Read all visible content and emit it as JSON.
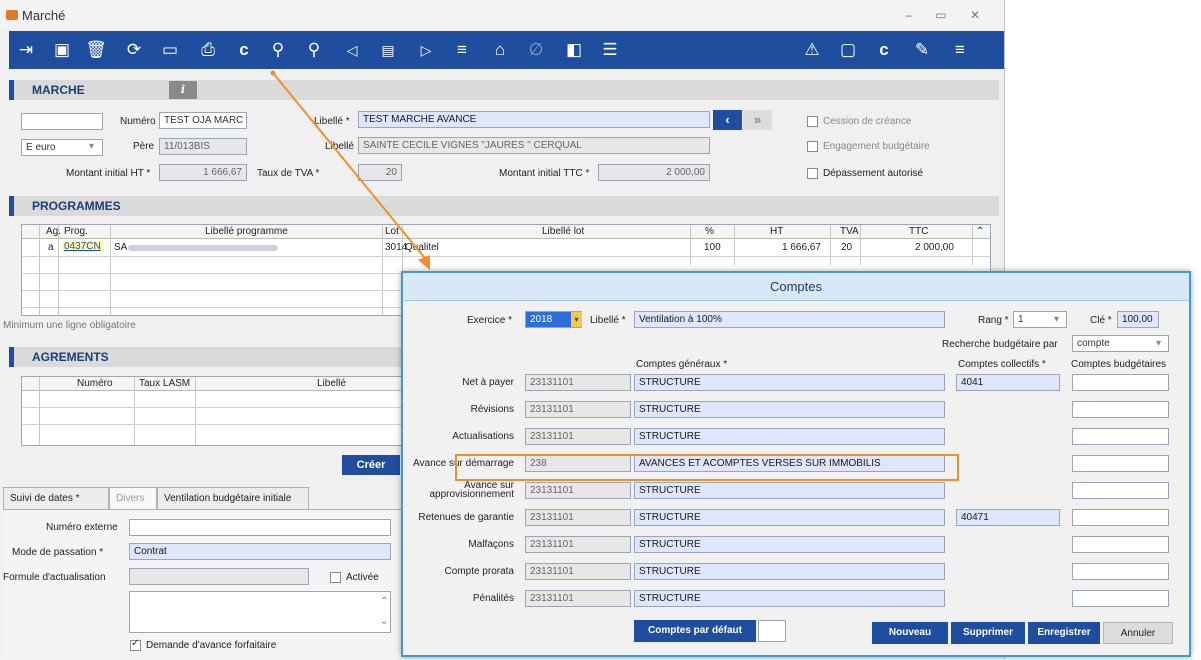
{
  "window": {
    "title": "Marché"
  },
  "toolbar": {
    "icons": [
      "export-icon",
      "save-icon",
      "delete-icon",
      "refresh-icon",
      "calendar-icon",
      "print-icon",
      "currency-icon",
      "search-abc-icon",
      "search-123-icon",
      "previous-icon",
      "list-icon",
      "next-icon",
      "filter-search-icon",
      "home-icon",
      "disabled-icon",
      "stack-icon",
      "menu-list-icon",
      "warning-icon",
      "report-icon",
      "currency-icon",
      "edit-icon",
      "hamburger-icon"
    ],
    "currency_glyph": "c"
  },
  "marche": {
    "section_title": "MARCHE",
    "info_glyph": "i",
    "numero_label": "Numéro",
    "numero_value": "TEST OJA MARC",
    "libelle_label": "Libellé *",
    "libelle_value": "TEST MARCHE AVANCE",
    "pere_label": "Père",
    "pere_value": "11/013BIS",
    "libelle2_label": "Libellé",
    "libelle2_value": "SAINTE CECILE VIGNES \"JAURES \" CERQUAL",
    "devise_value": "E euro",
    "montant_ht_label": "Montant initial HT *",
    "montant_ht_value": "1 666,67",
    "taux_tva_label": "Taux de TVA *",
    "taux_tva_value": "20",
    "montant_ttc_label": "Montant initial TTC *",
    "montant_ttc_value": "2 000,00",
    "cession_label": "Cession de créance",
    "engagement_label": "Engagement budgétaire",
    "depassement_label": "Dépassement autorisé"
  },
  "programmes": {
    "section_title": "PROGRAMMES",
    "columns": [
      "Ag.",
      "Prog.",
      "Libellé programme",
      "Lot",
      "Libellé lot",
      "%",
      "HT",
      "TVA",
      "TTC"
    ],
    "row": {
      "ag": "a",
      "prog": "0437CN",
      "libelle_prog": "SA",
      "lot": "3014",
      "libelle_lot": "Qualitel",
      "pct": "100",
      "ht": "1 666,67",
      "tva": "20",
      "ttc": "2 000,00"
    },
    "hint": "Minimum une ligne obligatoire"
  },
  "agrements": {
    "section_title": "AGREMENTS",
    "columns": [
      "Numéro",
      "Taux LASM",
      "Libellé"
    ],
    "creer_label": "Créer"
  },
  "tabs": [
    "Suivi de dates *",
    "Divers *",
    "Ventilation budgétaire initiale"
  ],
  "divers": {
    "numero_externe_label": "Numéro externe",
    "numero_externe_value": "",
    "mode_passation_label": "Mode de passation *",
    "mode_passation_value": "Contrat",
    "formule_label": "Formule d'actualisation",
    "activee_label": "Activée",
    "demande_label": "Demande d'avance forfaitaire"
  },
  "comptes": {
    "title": "Comptes",
    "exercice_label": "Exercice *",
    "exercice_value": "2018",
    "libelle_label": "Libellé *",
    "libelle_value": "Ventilation à 100%",
    "rang_label": "Rang *",
    "rang_value": "1",
    "cle_label": "Clé *",
    "cle_value": "100,00",
    "recherche_label": "Recherche budgétaire par",
    "recherche_value": "compte",
    "col_generaux": "Comptes généraux *",
    "col_collectifs": "Comptes collectifs *",
    "col_budgetaires": "Comptes budgétaires",
    "rows": [
      {
        "label": "Net à payer",
        "code": "23131101",
        "libelle": "STRUCTURE",
        "collectif": "4041"
      },
      {
        "label": "Révisions",
        "code": "23131101",
        "libelle": "STRUCTURE",
        "collectif": ""
      },
      {
        "label": "Actualisations",
        "code": "23131101",
        "libelle": "STRUCTURE",
        "collectif": ""
      },
      {
        "label": "Avance sur démarrage",
        "code": "238",
        "libelle": "AVANCES ET ACOMPTES VERSES SUR IMMOBILIS",
        "collectif": ""
      },
      {
        "label": "Avance sur approvisionnement",
        "code": "23131101",
        "libelle": "STRUCTURE",
        "collectif": ""
      },
      {
        "label": "Retenues de garantie",
        "code": "23131101",
        "libelle": "STRUCTURE",
        "collectif": "40471"
      },
      {
        "label": "Malfaçons",
        "code": "23131101",
        "libelle": "STRUCTURE",
        "collectif": ""
      },
      {
        "label": "Compte prorata",
        "code": "23131101",
        "libelle": "STRUCTURE",
        "collectif": ""
      },
      {
        "label": "Pénalités",
        "code": "23131101",
        "libelle": "STRUCTURE",
        "collectif": ""
      }
    ],
    "btn_defaut": "Comptes par défaut",
    "btn_nouveau": "Nouveau",
    "btn_supprimer": "Supprimer",
    "btn_enregistrer": "Enregistrer",
    "btn_annuler": "Annuler"
  },
  "colors": {
    "toolbar": "#1f4e9f",
    "highlight": "#ef8f2c",
    "dialog_border": "#3d9bd6"
  }
}
